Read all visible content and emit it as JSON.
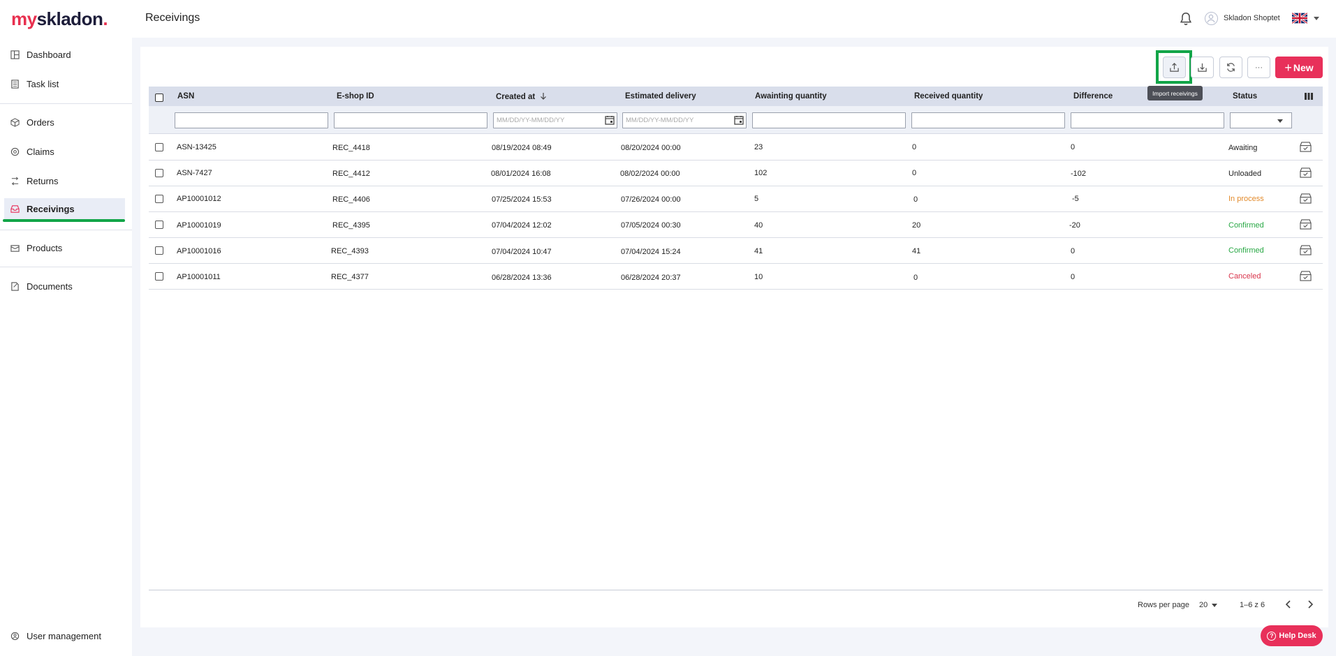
{
  "brand": {
    "logo_my": "my",
    "logo_rest": "skladon",
    "logo_dot": "."
  },
  "header": {
    "page_title": "Receivings",
    "user_name": "Skladon Shoptet"
  },
  "sidebar": {
    "items": [
      {
        "label": "Dashboard"
      },
      {
        "label": "Task list"
      },
      {
        "label": "Orders"
      },
      {
        "label": "Claims"
      },
      {
        "label": "Returns"
      },
      {
        "label": "Receivings"
      },
      {
        "label": "Products"
      },
      {
        "label": "Documents"
      }
    ],
    "user_management": "User management"
  },
  "toolbar": {
    "more_label": "···",
    "new_label": "New",
    "tooltip": "Import receivings"
  },
  "table": {
    "columns": [
      "ASN",
      "E-shop ID",
      "Created at",
      "Estimated delivery",
      "Awainting quantity",
      "Received quantity",
      "Difference",
      "Status"
    ],
    "date_placeholder": "MM/DD/YY-MM/DD/YY",
    "rows": [
      {
        "asn": "ASN-13425",
        "eshop": "REC_4418",
        "created": "08/19/2024 08:49",
        "delivery": "08/20/2024 00:00",
        "awaiting": "23",
        "received": "0",
        "difference": "0",
        "status": "Awaiting"
      },
      {
        "asn": "ASN-7427",
        "eshop": "REC_4412",
        "created": "08/01/2024 16:08",
        "delivery": "08/02/2024 00:00",
        "awaiting": "102",
        "received": "0",
        "difference": "-102",
        "status": "Unloaded"
      },
      {
        "asn": "AP10001012",
        "eshop": "REC_4406",
        "created": "07/25/2024 15:53",
        "delivery": "07/26/2024 00:00",
        "awaiting": "5",
        "received": "0",
        "difference": "-5",
        "status": "In process"
      },
      {
        "asn": "AP10001019",
        "eshop": "REC_4395",
        "created": "07/04/2024 12:02",
        "delivery": "07/05/2024 00:30",
        "awaiting": "40",
        "received": "20",
        "difference": "-20",
        "status": "Confirmed"
      },
      {
        "asn": "AP10001016",
        "eshop": "REC_4393",
        "created": "07/04/2024 10:47",
        "delivery": "07/04/2024 15:24",
        "awaiting": "41",
        "received": "41",
        "difference": "0",
        "status": "Confirmed"
      },
      {
        "asn": "AP10001011",
        "eshop": "REC_4377",
        "created": "06/28/2024 13:36",
        "delivery": "06/28/2024 20:37",
        "awaiting": "10",
        "received": "0",
        "difference": "0",
        "status": "Canceled"
      }
    ]
  },
  "pagination": {
    "rows_per_page_label": "Rows per page",
    "rows_per_page": "20",
    "range": "1–6 z 6"
  },
  "help": {
    "label": "Help Desk"
  },
  "colors": {
    "accent": "#e8305a",
    "highlight": "#12a548",
    "in_process": "#e28a2b",
    "confirmed": "#29a845",
    "canceled": "#d9344b"
  }
}
